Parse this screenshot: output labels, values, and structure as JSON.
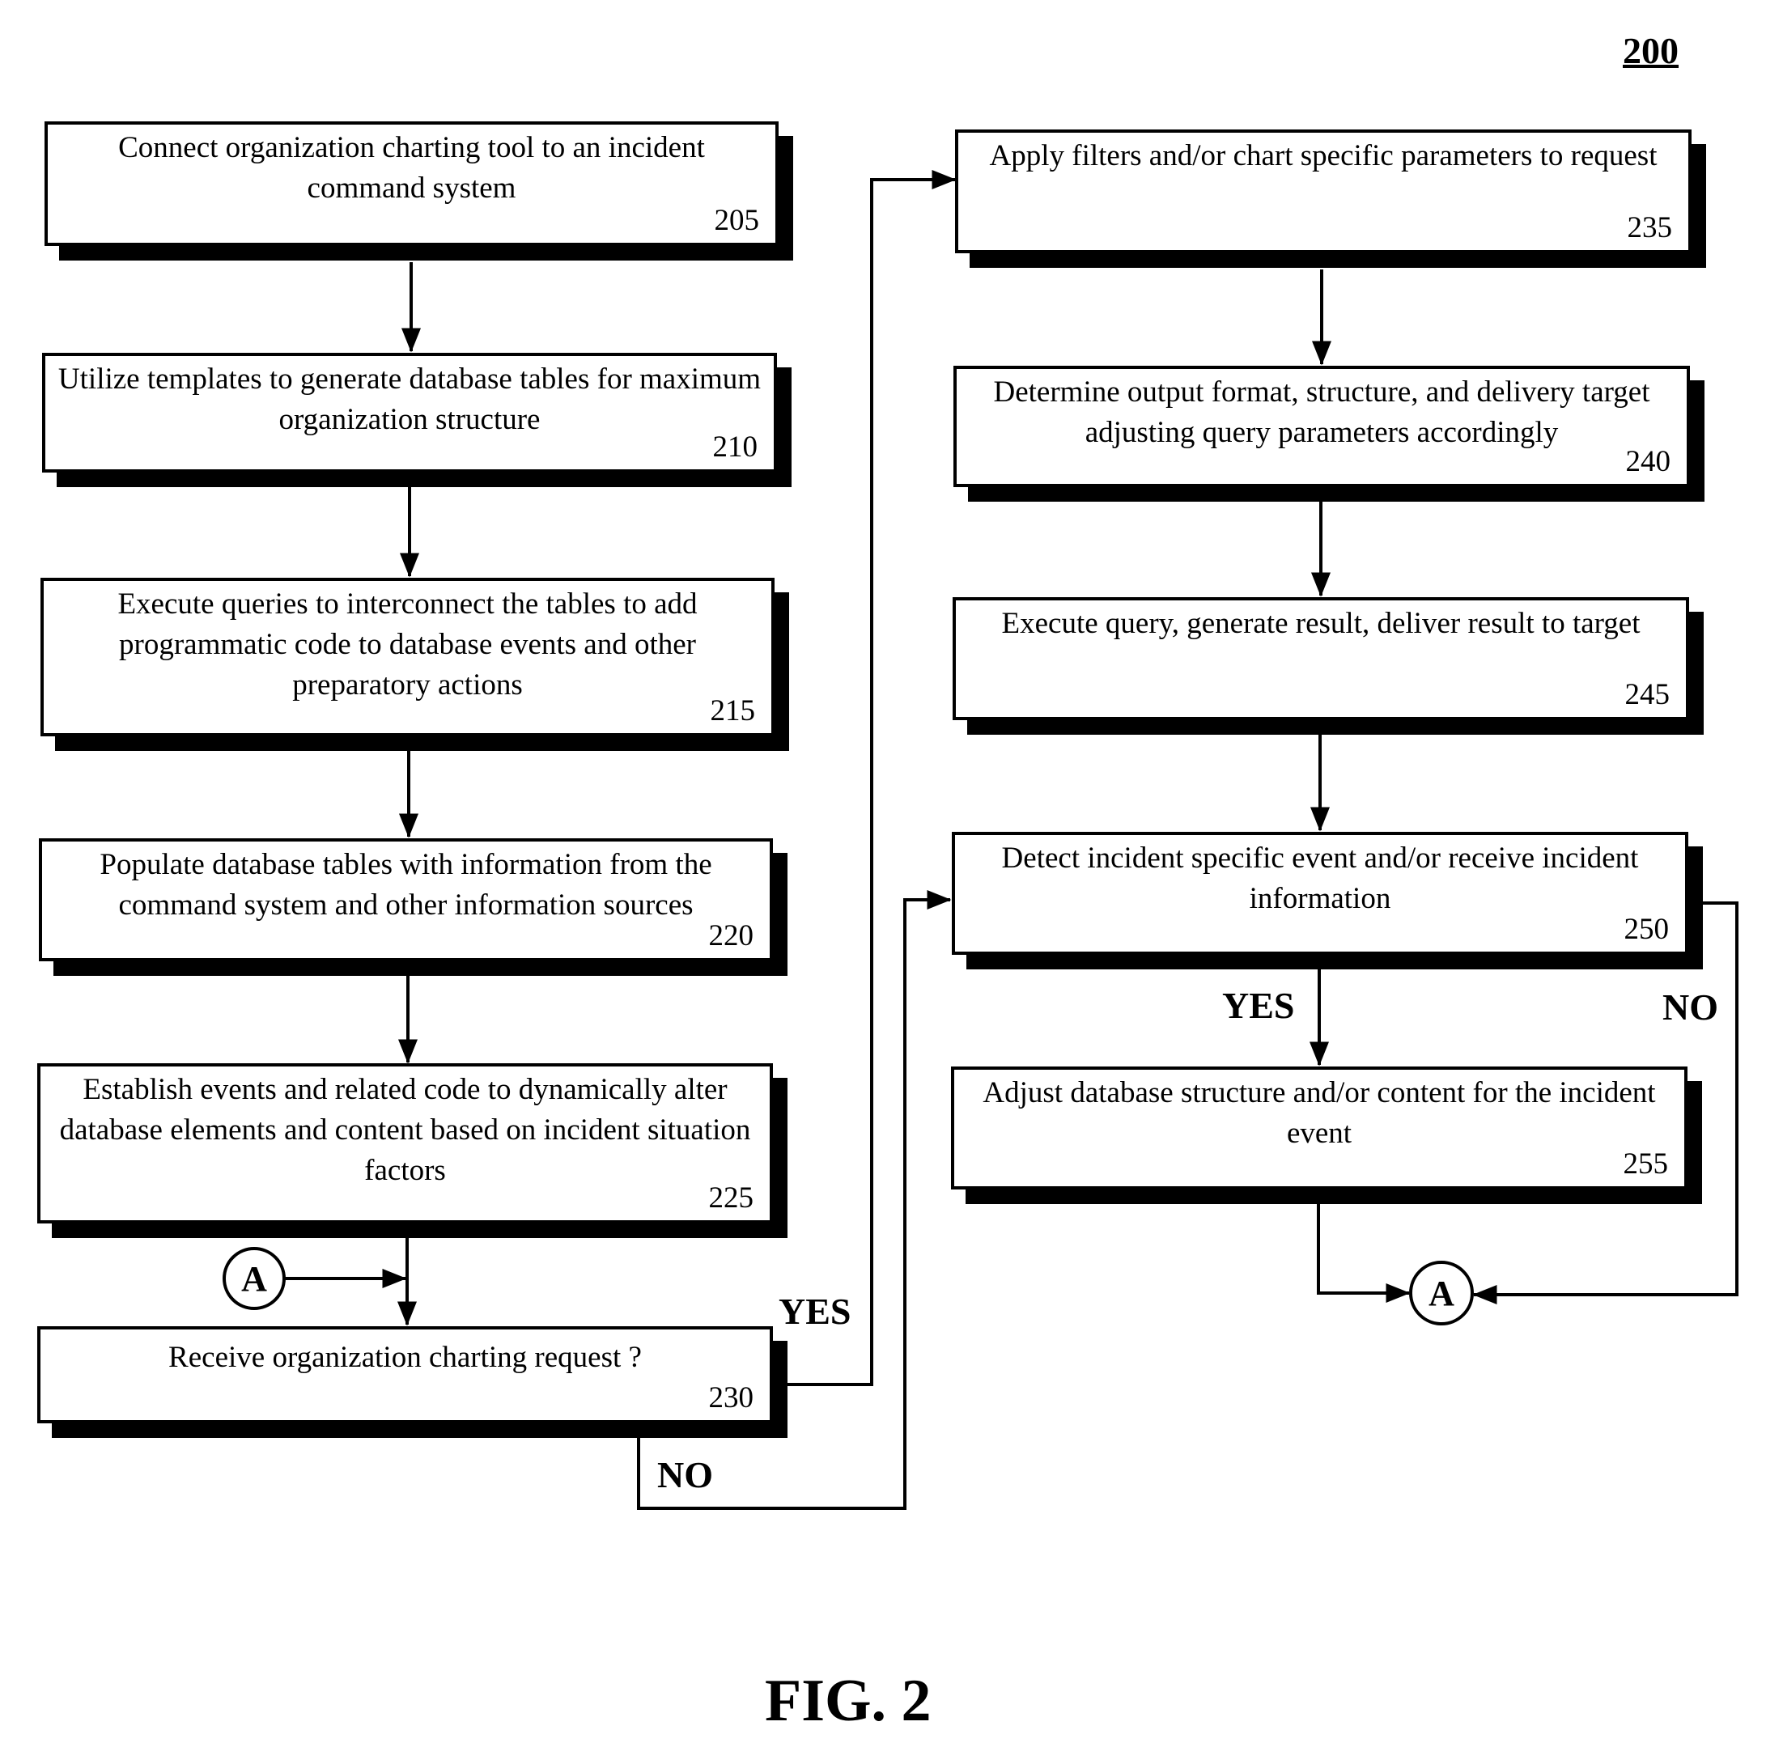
{
  "figure": {
    "reference_number": "200",
    "title": "FIG. 2"
  },
  "steps": [
    {
      "id": "205",
      "text": "Connect organization charting tool to an incident command system"
    },
    {
      "id": "210",
      "text": "Utilize templates to generate database tables for maximum organization structure"
    },
    {
      "id": "215",
      "text": "Execute queries to interconnect the tables to add programmatic code to database events and other preparatory actions"
    },
    {
      "id": "220",
      "text": "Populate database tables with information from the command system and other information sources"
    },
    {
      "id": "225",
      "text": "Establish events and related code to dynamically alter database elements and content based on incident situation factors"
    },
    {
      "id": "230",
      "text": "Receive organization charting request ?"
    },
    {
      "id": "235",
      "text": "Apply filters and/or chart specific parameters to request"
    },
    {
      "id": "240",
      "text": "Determine output format, structure, and delivery target adjusting query parameters accordingly"
    },
    {
      "id": "245",
      "text": "Execute query, generate result, deliver result to target"
    },
    {
      "id": "250",
      "text": "Detect incident specific event and/or receive incident information"
    },
    {
      "id": "255",
      "text": "Adjust database structure and/or content for the incident event"
    }
  ],
  "branch_labels": {
    "step230_yes": "YES",
    "step230_no": "NO",
    "step250_yes": "YES",
    "step250_no": "NO"
  },
  "connectors": {
    "left": "A",
    "right": "A"
  },
  "edges": [
    {
      "from": "205",
      "to": "210"
    },
    {
      "from": "210",
      "to": "215"
    },
    {
      "from": "215",
      "to": "220"
    },
    {
      "from": "220",
      "to": "225"
    },
    {
      "from": "225",
      "to": "230"
    },
    {
      "from": "A",
      "to": "230"
    },
    {
      "from": "230",
      "to": "235",
      "label": "YES"
    },
    {
      "from": "230",
      "to": "250",
      "label": "NO"
    },
    {
      "from": "235",
      "to": "240"
    },
    {
      "from": "240",
      "to": "245"
    },
    {
      "from": "245",
      "to": "250"
    },
    {
      "from": "250",
      "to": "255",
      "label": "YES"
    },
    {
      "from": "250",
      "to": "A",
      "label": "NO"
    },
    {
      "from": "255",
      "to": "A"
    }
  ]
}
